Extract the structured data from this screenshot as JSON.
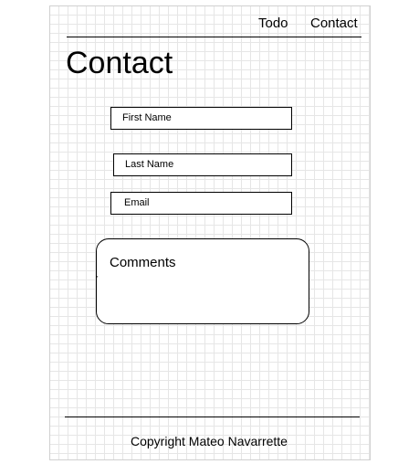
{
  "nav": {
    "items": [
      {
        "label": "Todo"
      },
      {
        "label": "Contact"
      }
    ]
  },
  "main": {
    "title": "Contact"
  },
  "form": {
    "first_name": {
      "placeholder": "First Name"
    },
    "last_name": {
      "placeholder": "Last Name"
    },
    "email": {
      "placeholder": "Email"
    },
    "comments": {
      "placeholder": "Comments"
    }
  },
  "footer": {
    "copyright": "Copyright Mateo Navarrette"
  },
  "colors": {
    "background": "#ffffff",
    "grid": "#e6e6e6",
    "ink": "#000000"
  }
}
